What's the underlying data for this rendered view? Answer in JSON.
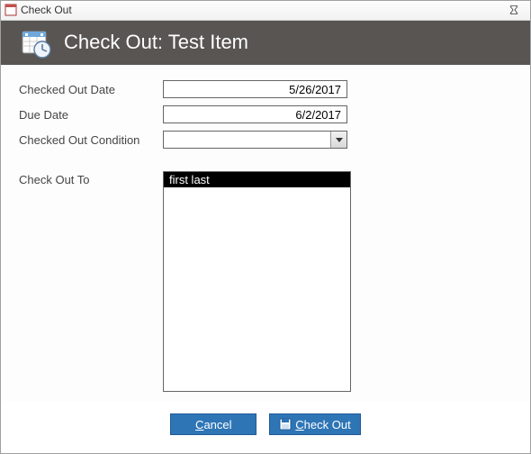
{
  "window": {
    "title": "Check Out"
  },
  "header": {
    "title": "Check Out: Test Item"
  },
  "fields": {
    "checked_out_date": {
      "label": "Checked Out Date",
      "value": "5/26/2017"
    },
    "due_date": {
      "label": "Due Date",
      "value": "6/2/2017"
    },
    "condition": {
      "label": "Checked Out Condition",
      "value": ""
    },
    "check_out_to": {
      "label": "Check Out To"
    }
  },
  "listbox": {
    "items": [
      {
        "label": "first last",
        "selected": true
      }
    ]
  },
  "buttons": {
    "cancel": {
      "label": "Cancel",
      "mnemonic_index": 0
    },
    "check_out": {
      "label": "Check Out",
      "mnemonic_index": 0
    }
  }
}
